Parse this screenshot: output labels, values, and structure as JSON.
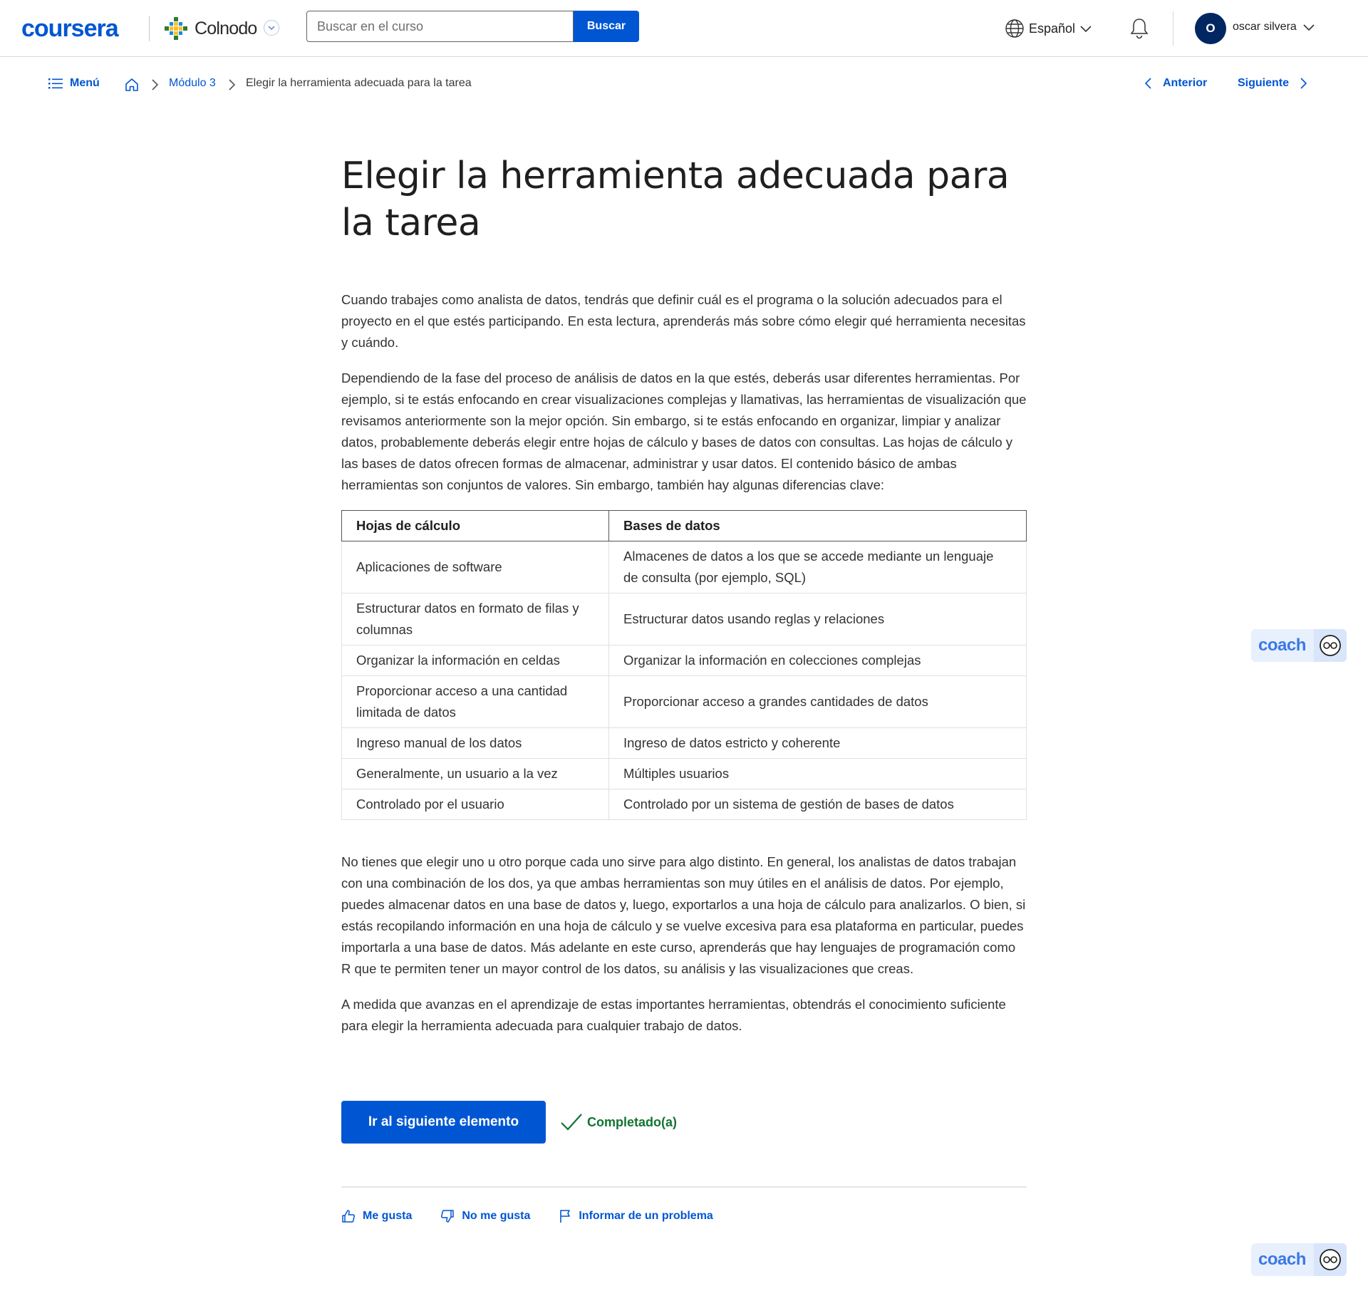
{
  "header": {
    "logo_text": "coursera",
    "partner_name": "Colnodo",
    "search": {
      "placeholder": "Buscar en el curso",
      "value": "",
      "button_label": "Buscar"
    },
    "language": "Español",
    "user": {
      "initial": "O",
      "name": "oscar silvera"
    }
  },
  "breadcrumb": {
    "menu_label": "Menú",
    "module_label": "Módulo 3",
    "current_label": "Elegir la herramienta adecuada para la tarea",
    "prev_label": "Anterior",
    "next_label": "Siguiente"
  },
  "article": {
    "title": "Elegir la herramienta adecuada para la tarea",
    "intro_paragraphs": [
      "Cuando trabajes como analista de datos, tendrás que definir cuál es el programa o la solución adecuados para el proyecto en el que estés participando. En esta lectura, aprenderás más sobre cómo elegir qué herramienta necesitas y cuándo.",
      "Dependiendo de la fase del proceso de análisis de datos en la que estés, deberás usar diferentes herramientas. Por ejemplo, si te estás enfocando en crear visualizaciones complejas y llamativas, las herramientas de visualización que revisamos anteriormente son la mejor opción. Sin embargo, si te estás enfocando en organizar, limpiar y analizar datos, probablemente deberás elegir entre hojas de cálculo y bases de datos con consultas. Las hojas de cálculo y las bases de datos ofrecen formas de almacenar, administrar y usar datos. El contenido básico de ambas herramientas son conjuntos de valores. Sin embargo, también hay algunas diferencias clave:"
    ],
    "table": {
      "headers": [
        "Hojas de cálculo",
        "Bases de datos"
      ],
      "rows": [
        [
          "Aplicaciones de software",
          "Almacenes de datos a los que se accede mediante un lenguaje de consulta (por ejemplo, SQL)"
        ],
        [
          "Estructurar datos en formato de filas y columnas",
          "Estructurar datos usando reglas y relaciones"
        ],
        [
          "Organizar la información en celdas",
          "Organizar la información en colecciones complejas"
        ],
        [
          "Proporcionar acceso a una cantidad limitada de datos",
          "Proporcionar acceso a grandes cantidades de datos"
        ],
        [
          "Ingreso manual de los datos",
          "Ingreso de datos estricto y coherente"
        ],
        [
          "Generalmente, un usuario a la vez",
          "Múltiples usuarios"
        ],
        [
          "Controlado por el usuario",
          "Controlado por un sistema de gestión de bases de datos"
        ]
      ]
    },
    "closing_paragraphs": [
      "No tienes que elegir uno u otro porque cada uno sirve para algo distinto. En general, los analistas de datos trabajan con una combinación de los dos, ya que ambas herramientas son muy útiles en el análisis de datos. Por ejemplo, puedes almacenar datos en una base de datos y, luego, exportarlos a una hoja de cálculo para analizarlos. O bien, si estás recopilando información en una hoja de cálculo y se vuelve excesiva para esa plataforma en particular, puedes importarla a una base de datos. Más adelante en este curso, aprenderás que hay lenguajes de programación como R que te permiten tener un mayor control de los datos, su análisis y las visualizaciones que creas.",
      "A medida que avanzas en el aprendizaje de estas importantes herramientas, obtendrás el conocimiento suficiente para elegir la herramienta adecuada para cualquier trabajo de datos."
    ]
  },
  "actions": {
    "next_item_label": "Ir al siguiente elemento",
    "completed_label": "Completado(a)"
  },
  "feedback": {
    "like_label": "Me gusta",
    "dislike_label": "No me gusta",
    "report_label": "Informar de un problema"
  },
  "coach": {
    "label": "coach"
  },
  "colors": {
    "brand": "#0056d2",
    "success": "#137333",
    "avatar": "#002761"
  }
}
